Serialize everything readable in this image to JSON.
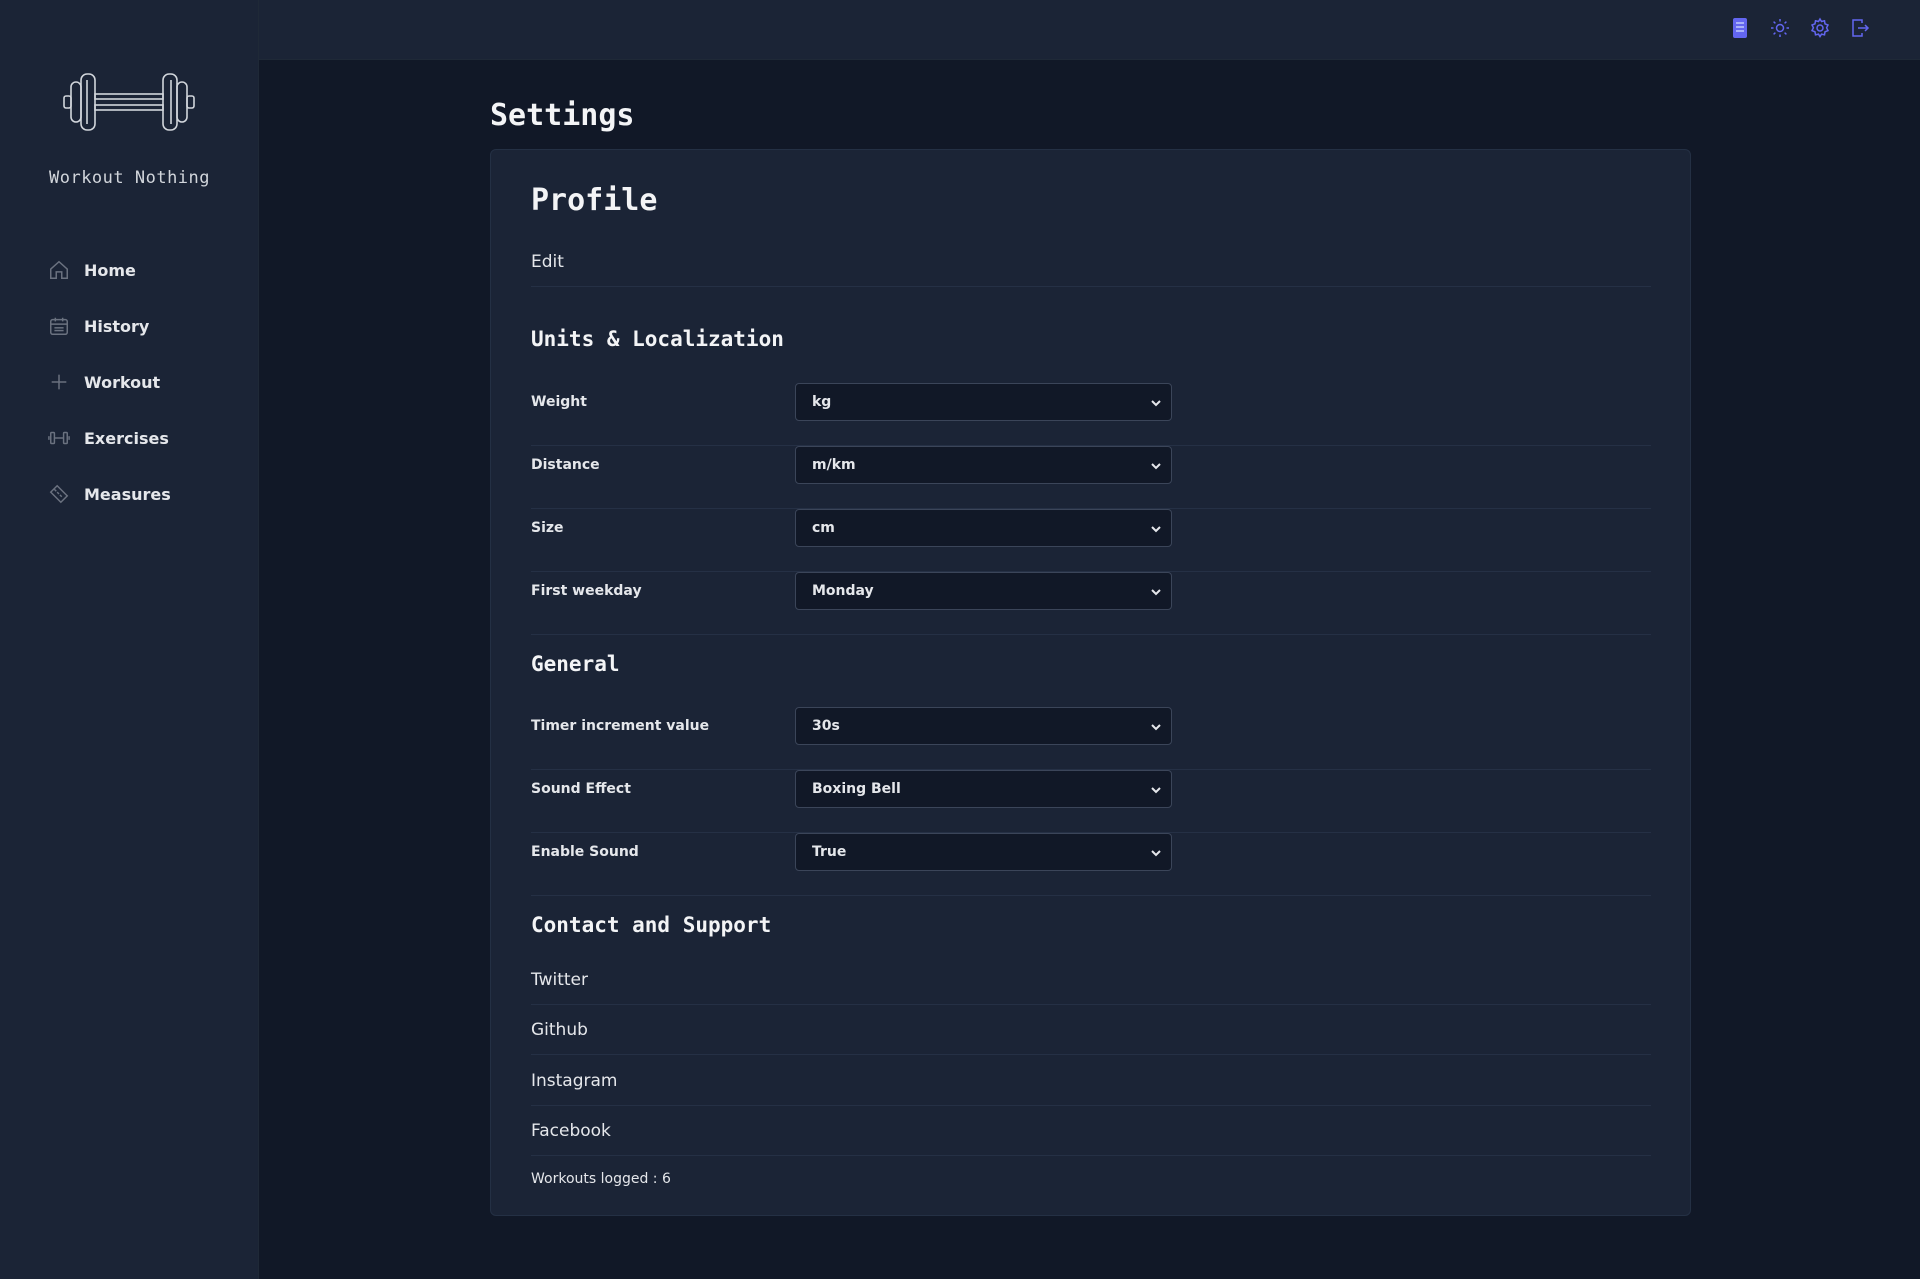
{
  "app": {
    "name": "Workout Nothing"
  },
  "sidebar": {
    "items": [
      {
        "label": "Home",
        "icon": "home-icon"
      },
      {
        "label": "History",
        "icon": "calendar-icon"
      },
      {
        "label": "Workout",
        "icon": "plus-icon"
      },
      {
        "label": "Exercises",
        "icon": "dumbbell-icon"
      },
      {
        "label": "Measures",
        "icon": "ruler-icon"
      }
    ]
  },
  "topbar": {
    "icons": [
      "notebook-icon",
      "sun-icon",
      "gear-icon",
      "logout-icon"
    ],
    "accent": "#6366f1"
  },
  "main": {
    "title": "Settings",
    "profile": {
      "title": "Profile",
      "edit_label": "Edit"
    },
    "units": {
      "title": "Units & Localization",
      "settings": [
        {
          "label": "Weight",
          "value": "kg"
        },
        {
          "label": "Distance",
          "value": "m/km"
        },
        {
          "label": "Size",
          "value": "cm"
        },
        {
          "label": "First weekday",
          "value": "Monday"
        }
      ]
    },
    "general": {
      "title": "General",
      "settings": [
        {
          "label": "Timer increment value",
          "value": "30s"
        },
        {
          "label": "Sound Effect",
          "value": "Boxing Bell"
        },
        {
          "label": "Enable Sound",
          "value": "True"
        }
      ]
    },
    "contact": {
      "title": "Contact and Support",
      "links": [
        "Twitter",
        "Github",
        "Instagram",
        "Facebook"
      ]
    },
    "footer": "Workouts logged : 6"
  }
}
